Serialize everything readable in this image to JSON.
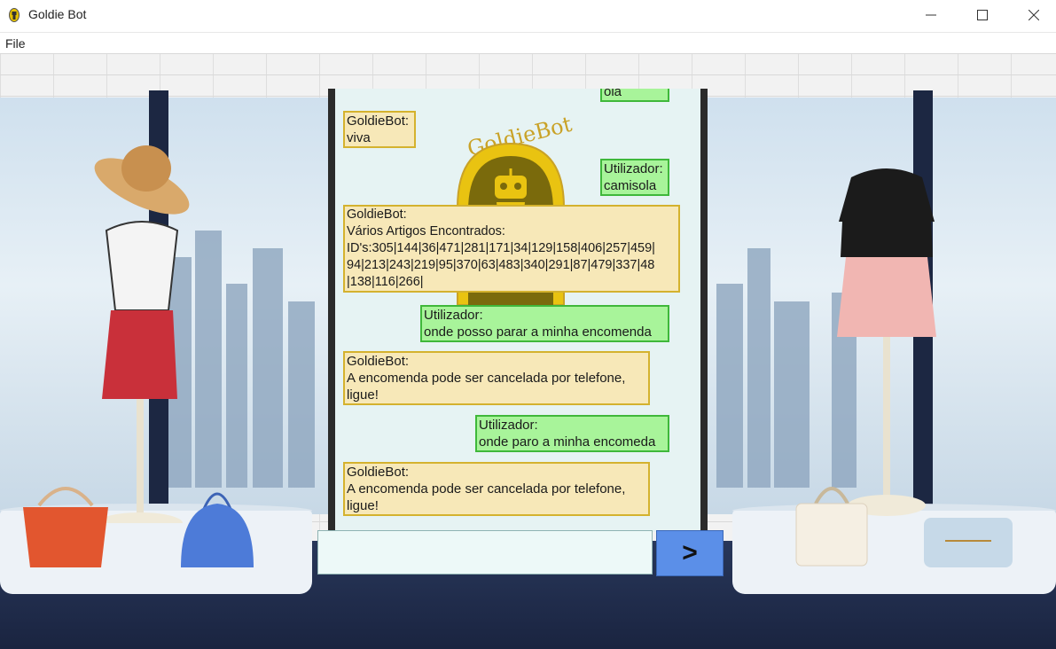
{
  "window": {
    "title": "Goldie Bot"
  },
  "menu": {
    "file_label": "File"
  },
  "logo": {
    "text": "GoldieBot"
  },
  "chat": {
    "messages": [
      {
        "role": "user",
        "lines": [
          "ola"
        ]
      },
      {
        "role": "bot",
        "lines": [
          "GoldieBot:",
          "viva"
        ]
      },
      {
        "role": "user",
        "lines": [
          "Utilizador:",
          "camisola"
        ]
      },
      {
        "role": "bot",
        "lines": [
          "GoldieBot:",
          "Vários Artigos Encontrados:",
          "ID's:305|144|36|471|281|171|34|129|158|406|257|459|",
          "94|213|243|219|95|370|63|483|340|291|87|479|337|48",
          "|138|116|266|"
        ]
      },
      {
        "role": "user",
        "lines": [
          "Utilizador:",
          "onde posso parar a minha encomenda"
        ]
      },
      {
        "role": "bot",
        "lines": [
          "GoldieBot:",
          "A encomenda pode ser cancelada por telefone,",
          "ligue!"
        ]
      },
      {
        "role": "user",
        "lines": [
          "Utilizador:",
          "onde paro a minha encomeda"
        ]
      },
      {
        "role": "bot",
        "lines": [
          "GoldieBot:",
          "A encomenda pode ser cancelada por telefone,",
          "ligue!"
        ]
      }
    ]
  },
  "input": {
    "value": "",
    "placeholder": ""
  },
  "send_button": {
    "label": ">"
  },
  "colors": {
    "bot_bubble": "#f7e8b8",
    "bot_border": "#d4b22e",
    "user_bubble": "#a8f49a",
    "user_border": "#3fb83a",
    "send_button": "#5b8fe8",
    "logo_gold": "#c9a227"
  },
  "icons": {
    "app": "goldie-robot-icon",
    "minimize": "minimize-icon",
    "maximize": "maximize-icon",
    "close": "close-icon"
  }
}
